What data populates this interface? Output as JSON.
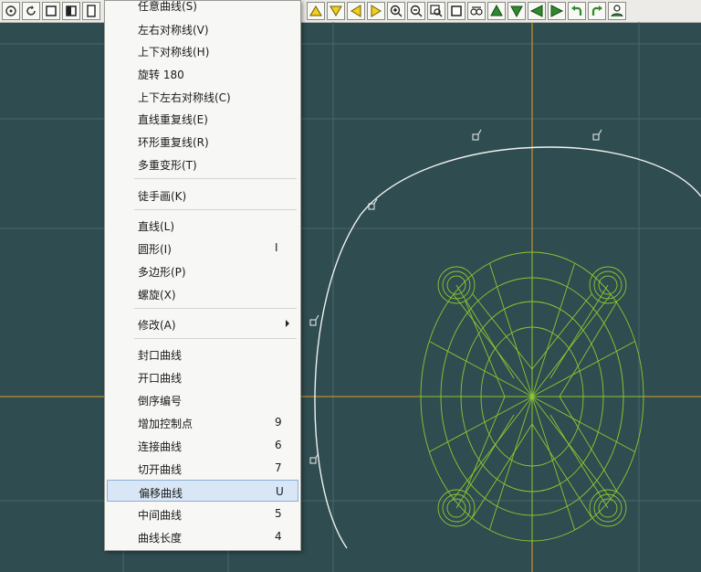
{
  "colors": {
    "canvas_bg": "#2f4c50",
    "grid": "#49676b",
    "axis": "#e0a12a",
    "outline": "#f2f2f2",
    "wire": "#8bc831",
    "menu_bg": "#f7f7f5",
    "menu_highlight": "#d8e6f5"
  },
  "toolbar": {
    "left_icons": [
      "cursor-icon",
      "rotate-icon",
      "square-icon",
      "half-square-icon",
      "document-icon"
    ],
    "right_icons": [
      "triangle-up-icon",
      "triangle-down-icon",
      "triangle-left-icon",
      "triangle-right-icon",
      "zoom-in-icon",
      "zoom-out-icon",
      "zoom-fit-icon",
      "square-icon",
      "group-icon",
      "solid-up-icon",
      "solid-down-icon",
      "solid-left-icon",
      "solid-right-icon",
      "undo-icon",
      "redo-icon",
      "person-icon"
    ]
  },
  "menu": {
    "items": [
      {
        "label": "任意曲线(S)",
        "shortcut": ""
      },
      {
        "label": "左右对称线(V)",
        "shortcut": ""
      },
      {
        "label": "上下对称线(H)",
        "shortcut": ""
      },
      {
        "label": "旋转 180",
        "shortcut": ""
      },
      {
        "label": "上下左右对称线(C)",
        "shortcut": ""
      },
      {
        "label": "直线重复线(E)",
        "shortcut": ""
      },
      {
        "label": "环形重复线(R)",
        "shortcut": ""
      },
      {
        "label": "多重变形(T)",
        "shortcut": ""
      },
      {
        "label": "徒手画(K)",
        "shortcut": ""
      },
      {
        "label": "直线(L)",
        "shortcut": ""
      },
      {
        "label": "圆形(I)",
        "shortcut": "I"
      },
      {
        "label": "多边形(P)",
        "shortcut": ""
      },
      {
        "label": "螺旋(X)",
        "shortcut": ""
      },
      {
        "label": "修改(A)",
        "shortcut": "",
        "submenu": true
      },
      {
        "label": "封口曲线",
        "shortcut": ""
      },
      {
        "label": "开口曲线",
        "shortcut": ""
      },
      {
        "label": "倒序编号",
        "shortcut": ""
      },
      {
        "label": "增加控制点",
        "shortcut": "9"
      },
      {
        "label": "连接曲线",
        "shortcut": "6"
      },
      {
        "label": "切开曲线",
        "shortcut": "7"
      },
      {
        "label": "偏移曲线",
        "shortcut": "U",
        "highlighted": true
      },
      {
        "label": "中间曲线",
        "shortcut": "5"
      },
      {
        "label": "曲线长度",
        "shortcut": "4"
      }
    ]
  }
}
